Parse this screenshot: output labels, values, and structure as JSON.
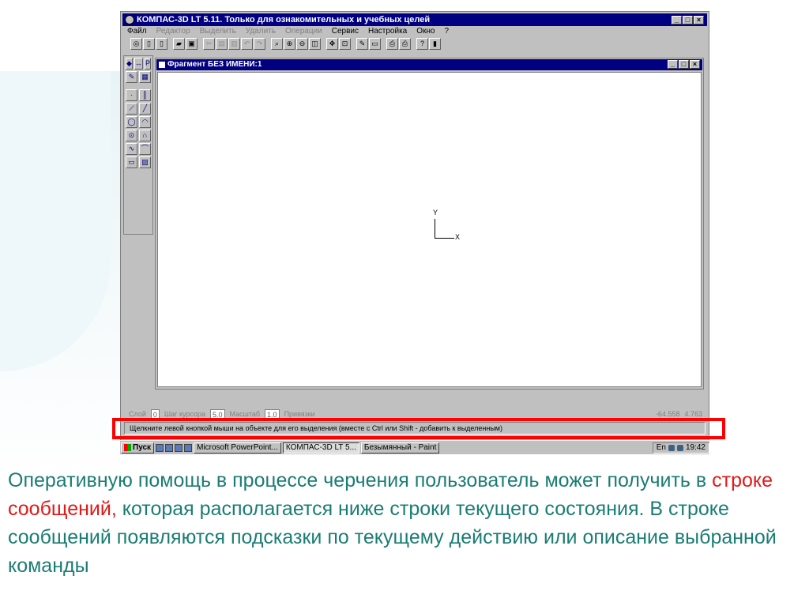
{
  "window": {
    "title": "КОМПАС-3D LT 5.11. Только для ознакомительных и учебных целей",
    "controls": [
      "_",
      "□",
      "×"
    ]
  },
  "menu": [
    {
      "label": "Файл",
      "disabled": false
    },
    {
      "label": "Редактор",
      "disabled": true
    },
    {
      "label": "Выделить",
      "disabled": true
    },
    {
      "label": "Удалить",
      "disabled": true
    },
    {
      "label": "Операции",
      "disabled": true
    },
    {
      "label": "Сервис",
      "disabled": false
    },
    {
      "label": "Настройка",
      "disabled": false
    },
    {
      "label": "Окно",
      "disabled": false
    },
    {
      "label": "?",
      "disabled": false
    }
  ],
  "document": {
    "title": "Фрагмент БЕЗ ИМЕНИ:1",
    "axis_y": "Y",
    "axis_x": "X"
  },
  "panel": {
    "tab1": "Р"
  },
  "statusbar": {
    "layer_label": "Слой",
    "layer_value": "0",
    "step_label": "Шаг курсора",
    "step_value": "5.0",
    "scale_label": "Масштаб",
    "scale_value": "1.0",
    "snap_label": "Привязки",
    "x_value": "-64.558",
    "y_value": "4.763"
  },
  "message_bar": {
    "text": "Щелкните левой кнопкой мыши на объекте для его выделения (вместе с Ctrl или Shift - добавить к выделенным)"
  },
  "taskbar": {
    "start": "Пуск",
    "tasks": [
      "Microsoft PowerPoint...",
      "КОМПАС-3D LT 5...",
      "Безымянный - Paint"
    ],
    "lang": "En",
    "time": "19:42"
  },
  "caption": {
    "part1": "Оперативную помощь в процессе черчения пользователь может получить в ",
    "highlight": "строке сообщений,",
    "part2": " которая располагается ниже строки текущего состояния. В строке сообщений появляются подсказки по текущему действию или описание выбранной команды"
  }
}
